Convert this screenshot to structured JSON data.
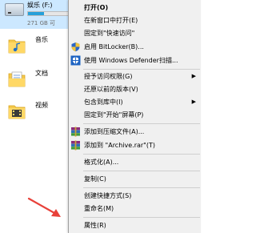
{
  "explorer": {
    "drive": {
      "name": "娱乐 (F:)",
      "size_text": "271 GB 可",
      "fill": 0.35
    },
    "items": [
      {
        "label": "音乐",
        "icon": "music-folder-icon"
      },
      {
        "label": "文档",
        "icon": "documents-folder-icon"
      },
      {
        "label": "视频",
        "icon": "videos-folder-icon"
      }
    ]
  },
  "menu": {
    "open": "打开(O)",
    "open_new_window": "在新窗口中打开(E)",
    "pin_quick_access": "固定到\"快速访问\"",
    "bitlocker": "启用 BitLocker(B)...",
    "defender": "使用 Windows Defender扫描...",
    "grant_access": "授予访问权限(G)",
    "restore_versions": "还原以前的版本(V)",
    "include_library": "包含到库中(I)",
    "pin_start": "固定到\"开始\"屏幕(P)",
    "add_archive": "添加到压缩文件(A)...",
    "add_archive_rar": "添加到 \"Archive.rar\"(T)",
    "format": "格式化(A)...",
    "copy": "复制(C)",
    "create_shortcut": "创建快捷方式(S)",
    "rename": "重命名(M)",
    "properties": "属性(R)"
  },
  "colors": {
    "selection": "#cce8ff",
    "menu_bg": "#f0f0f0",
    "annotation": "#e8413a"
  }
}
